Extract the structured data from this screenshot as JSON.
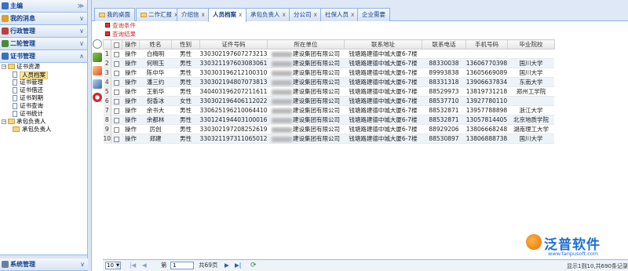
{
  "sidebar": {
    "headers": [
      {
        "label": "主编",
        "color": "#3a6fc4"
      },
      {
        "label": "我的消息",
        "color": "#e0a020"
      },
      {
        "label": "行政管理",
        "color": "#c04040"
      },
      {
        "label": "二轮管理",
        "color": "#4a8a3a"
      },
      {
        "label": "证书管理",
        "color": "#3a6fc4"
      }
    ],
    "chevron_collapsed": "≫",
    "chevron_expanded": "∧",
    "tree": [
      {
        "label": "证书资源",
        "level": 0,
        "type": "folder",
        "toggle": "−"
      },
      {
        "label": "人员档案",
        "level": 1,
        "type": "doc",
        "selected": true
      },
      {
        "label": "证书管理",
        "level": 1,
        "type": "doc"
      },
      {
        "label": "证书借还",
        "level": 1,
        "type": "doc"
      },
      {
        "label": "证书到期",
        "level": 1,
        "type": "doc"
      },
      {
        "label": "证书查询",
        "level": 1,
        "type": "doc"
      },
      {
        "label": "证书统计",
        "level": 1,
        "type": "doc"
      },
      {
        "label": "承包负责人",
        "level": 0,
        "type": "folder",
        "toggle": "−"
      },
      {
        "label": "承包负责人",
        "level": 1,
        "type": "doc"
      }
    ],
    "footer": "系统管理"
  },
  "tabs": [
    {
      "label": "我的桌面",
      "closable": false
    },
    {
      "label": "二作汇报",
      "closable": true
    },
    {
      "label": "介绍信",
      "closable": true
    },
    {
      "label": "人员档案",
      "closable": true,
      "active": true
    },
    {
      "label": "承包负责人",
      "closable": true
    },
    {
      "label": "分公司",
      "closable": true
    },
    {
      "label": "社保人员",
      "closable": true
    },
    {
      "label": "企业需要",
      "closable": false
    }
  ],
  "tab_close": "x",
  "actions": {
    "query_condition": "查询条件",
    "query_result": "查询结果"
  },
  "grid": {
    "headers": [
      "",
      "",
      "操作",
      "姓名",
      "性别",
      "证件号码",
      "所在单位",
      "联系地址",
      "联系电话",
      "手机号码",
      "毕业院校"
    ],
    "rows": [
      {
        "n": "1",
        "op": "操作",
        "name": "白梅明",
        "sex": "男性",
        "id": "330302197607273213",
        "unit": "建设集团有限公司",
        "addr": "钱塘路建德中城大厦6-7楼",
        "tel": "",
        "mobile": "",
        "school": ""
      },
      {
        "n": "2",
        "op": "操作",
        "name": "何明玉",
        "sex": "男性",
        "id": "330321197603083061",
        "unit": "建设集团有限公司",
        "addr": "钱塘路建德中城大厦6-7楼",
        "tel": "88330038",
        "mobile": "13606770398",
        "school": "国川大学"
      },
      {
        "n": "3",
        "op": "操作",
        "name": "陈中华",
        "sex": "男性",
        "id": "330303196212100310",
        "unit": "建设集团有限公司",
        "addr": "钱塘路建德中城大厦6-7楼",
        "tel": "89993838",
        "mobile": "13605669089",
        "school": "国川大学"
      },
      {
        "n": "4",
        "op": "操作",
        "name": "潘三约",
        "sex": "男性",
        "id": "330302194807073813",
        "unit": "建设集团有限公司",
        "addr": "钱塘路建德中城大厦6-7楼",
        "tel": "88331318",
        "mobile": "13906637834",
        "school": "东南大学"
      },
      {
        "n": "5",
        "op": "操作",
        "name": "王新华",
        "sex": "男性",
        "id": "340403196207211611",
        "unit": "建设集团有限公司",
        "addr": "钱塘路建德中城大厦6-7楼",
        "tel": "88529973",
        "mobile": "13819731218",
        "school": "郑州工学院"
      },
      {
        "n": "6",
        "op": "操作",
        "name": "倪香冰",
        "sex": "女性",
        "id": "330302196406112022",
        "unit": "建设集团有限公司",
        "addr": "钱塘路建德中城大厦6-7楼",
        "tel": "88537710",
        "mobile": "13927780110",
        "school": ""
      },
      {
        "n": "7",
        "op": "操作",
        "name": "余书大",
        "sex": "男性",
        "id": "330625196210064410",
        "unit": "建设集团有限公司",
        "addr": "钱塘路建德中城大厦6-7楼",
        "tel": "88532871",
        "mobile": "13957788898",
        "school": "浙江大学"
      },
      {
        "n": "8",
        "op": "操作",
        "name": "余都林",
        "sex": "男性",
        "id": "330124194403100016",
        "unit": "建设集团有限公司",
        "addr": "钱塘路建德中城大厦6-7楼",
        "tel": "88532871",
        "mobile": "13057814405",
        "school": "北京地质学院"
      },
      {
        "n": "9",
        "op": "操作",
        "name": "厉创",
        "sex": "男性",
        "id": "330302197208252619",
        "unit": "建设集团有限公司",
        "addr": "钱塘路建德中城大厦6-7楼",
        "tel": "88929206",
        "mobile": "13806668248",
        "school": "湖南理工大学"
      },
      {
        "n": "10",
        "op": "操作",
        "name": "郑建",
        "sex": "男性",
        "id": "330321197311065012",
        "unit": "建设集团有限公司",
        "addr": "钱塘路建德中城大厦6-7楼",
        "tel": "88530897",
        "mobile": "13806888738",
        "school": "国川大学"
      }
    ]
  },
  "pager": {
    "page_size": "10",
    "first": "|◀",
    "prev": "◀",
    "page_label": "第",
    "page_value": "1",
    "total_pages": "共69页",
    "next": "▶",
    "last": "▶|",
    "refresh": "⟳"
  },
  "status_text": "显示1到10,共690条记录",
  "logo": {
    "name": "泛普软件",
    "url": "www.fanpusoft.com"
  },
  "colors": {
    "accent": "#15428b",
    "border": "#99bbe8",
    "link_red": "#cc3333",
    "logo_blue": "#1f6fcf",
    "logo_orange": "#e76f00"
  }
}
